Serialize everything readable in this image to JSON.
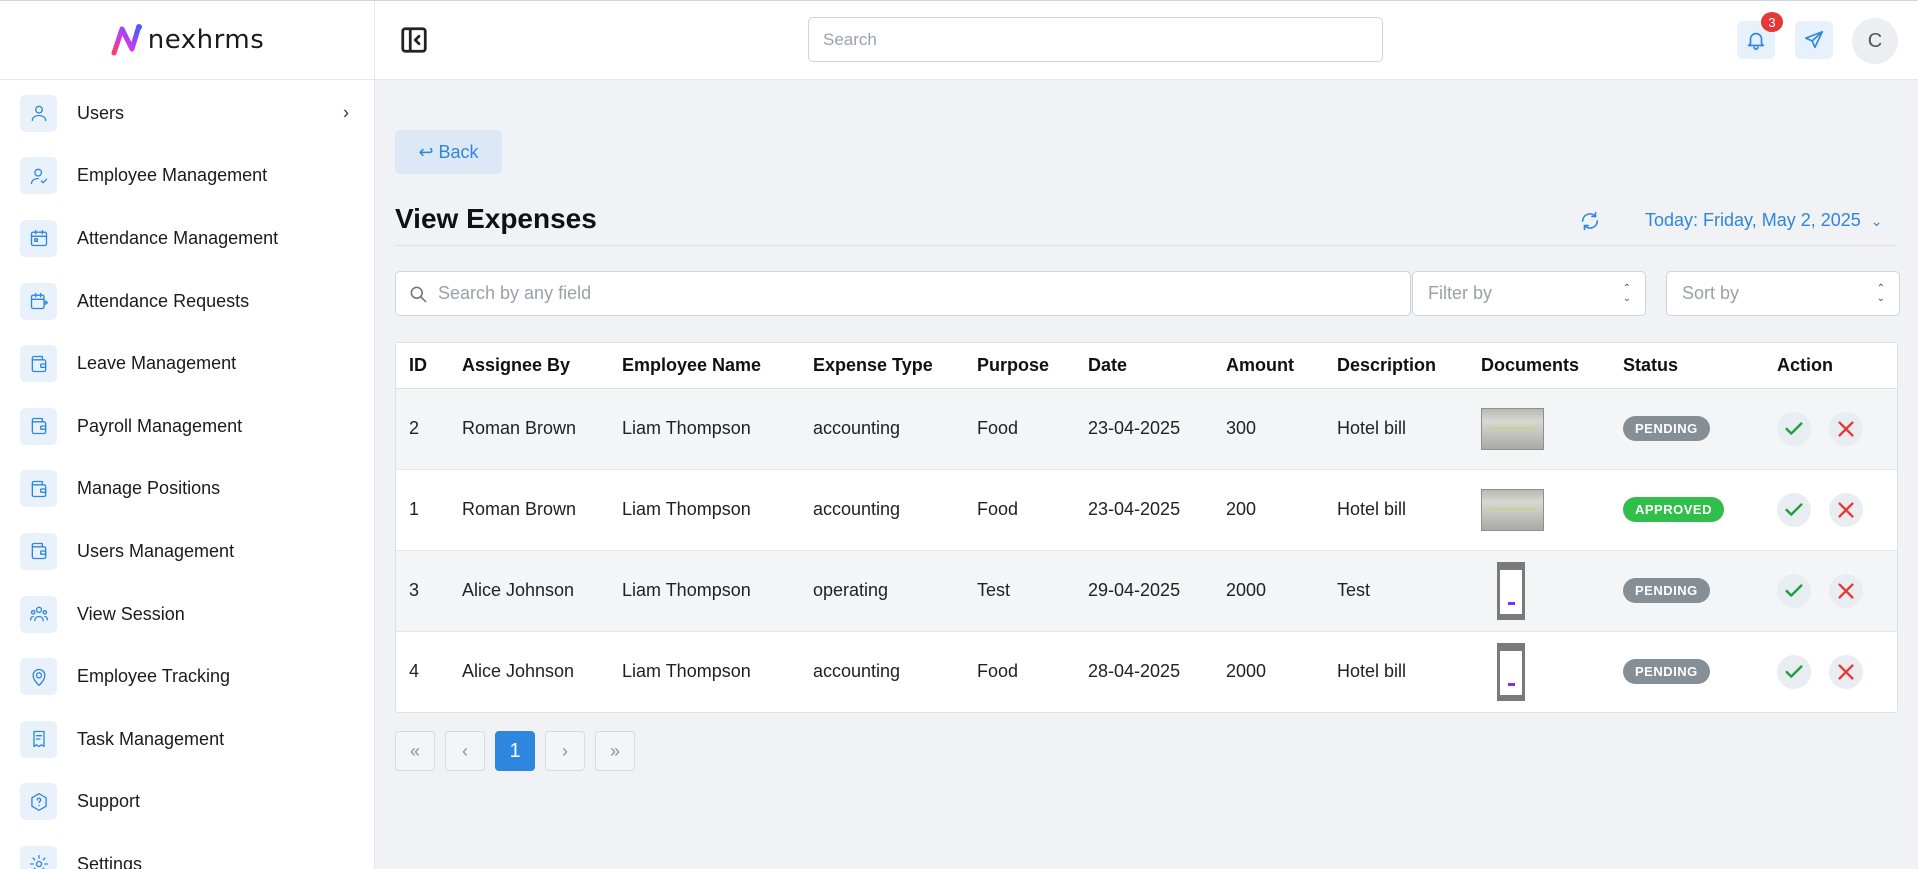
{
  "app": {
    "logo_text": "nexhrms"
  },
  "sidebar": {
    "items": [
      {
        "label": "Users",
        "icon": "user-icon",
        "has_submenu": true
      },
      {
        "label": "Employee Management",
        "icon": "user-check-icon"
      },
      {
        "label": "Attendance Management",
        "icon": "calendar-icon"
      },
      {
        "label": "Attendance Requests",
        "icon": "calendar-request-icon"
      },
      {
        "label": "Leave Management",
        "icon": "wallet-icon"
      },
      {
        "label": "Payroll Management",
        "icon": "wallet-icon"
      },
      {
        "label": "Manage Positions",
        "icon": "wallet-icon"
      },
      {
        "label": "Users Management",
        "icon": "wallet-icon"
      },
      {
        "label": "View Session",
        "icon": "users-group-icon"
      },
      {
        "label": "Employee Tracking",
        "icon": "location-pin-icon"
      },
      {
        "label": "Task Management",
        "icon": "clipboard-icon"
      },
      {
        "label": "Support",
        "icon": "help-icon"
      },
      {
        "label": "Settings",
        "icon": "gear-icon"
      }
    ]
  },
  "header": {
    "search_placeholder": "Search",
    "notification_count": "3",
    "avatar_initial": "C"
  },
  "main": {
    "back_label": "↩ Back",
    "title": "View Expenses",
    "date_label": "Today: Friday, May 2, 2025",
    "search_placeholder": "Search by any field",
    "filter_placeholder": "Filter by",
    "sort_placeholder": "Sort by"
  },
  "table": {
    "columns": [
      "ID",
      "Assignee By",
      "Employee Name",
      "Expense Type",
      "Purpose",
      "Date",
      "Amount",
      "Description",
      "Documents",
      "Status",
      "Action"
    ],
    "rows": [
      {
        "id": "2",
        "assignee": "Roman Brown",
        "employee": "Liam Thompson",
        "type": "accounting",
        "purpose": "Food",
        "date": "23-04-2025",
        "amount": "300",
        "description": "Hotel bill",
        "document": "receipt-landscape",
        "status": "PENDING"
      },
      {
        "id": "1",
        "assignee": "Roman Brown",
        "employee": "Liam Thompson",
        "type": "accounting",
        "purpose": "Food",
        "date": "23-04-2025",
        "amount": "200",
        "description": "Hotel bill",
        "document": "receipt-landscape",
        "status": "APPROVED"
      },
      {
        "id": "3",
        "assignee": "Alice Johnson",
        "employee": "Liam Thompson",
        "type": "operating",
        "purpose": "Test",
        "date": "29-04-2025",
        "amount": "2000",
        "description": "Test",
        "document": "phone-screenshot",
        "status": "PENDING"
      },
      {
        "id": "4",
        "assignee": "Alice Johnson",
        "employee": "Liam Thompson",
        "type": "accounting",
        "purpose": "Food",
        "date": "28-04-2025",
        "amount": "2000",
        "description": "Hotel bill",
        "document": "phone-screenshot",
        "status": "PENDING"
      }
    ]
  },
  "pagination": {
    "first": "«",
    "prev": "‹",
    "current": "1",
    "next": "›",
    "last": "»"
  },
  "colors": {
    "accent": "#2e86de",
    "pending": "#868e96",
    "approved": "#2fbf4a",
    "reject": "#e53935",
    "approve": "#1e9e3a"
  }
}
